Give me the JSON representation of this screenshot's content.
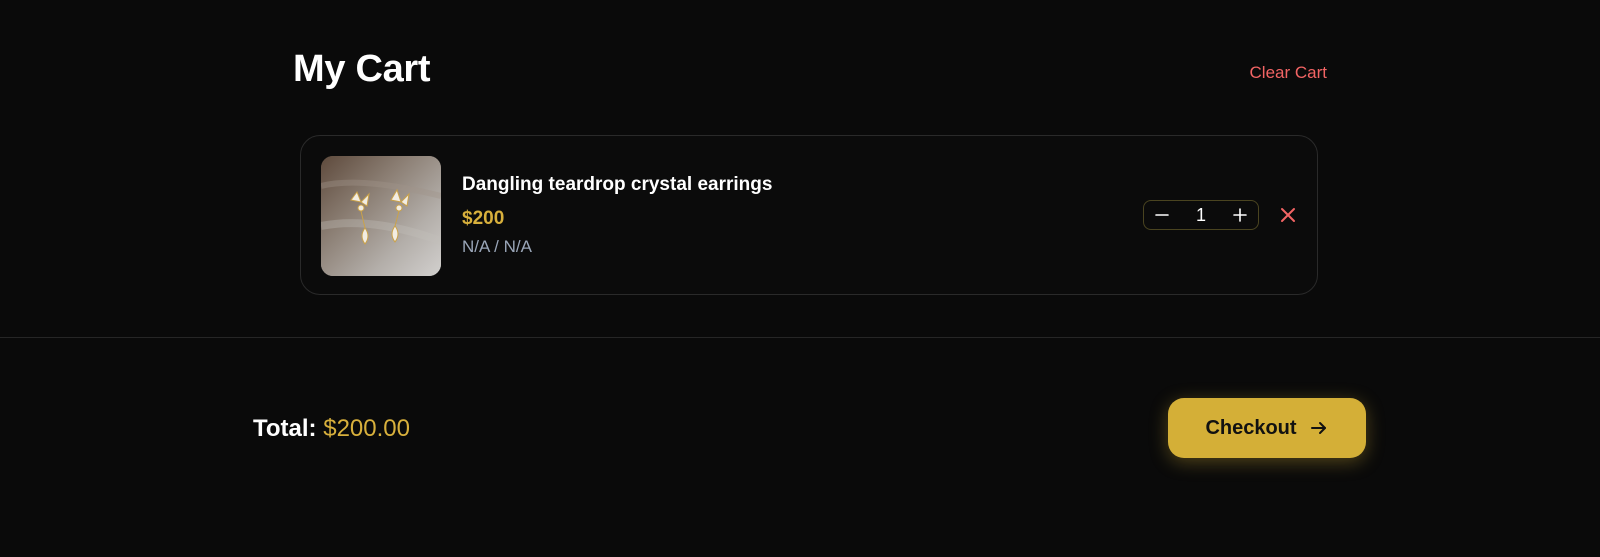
{
  "header": {
    "title": "My Cart",
    "clear_label": "Clear Cart"
  },
  "cart": {
    "items": [
      {
        "name": "Dangling teardrop crystal earrings",
        "price": "$200",
        "variant": "N/A / N/A",
        "quantity": "1",
        "image_icon": "earrings-photo"
      }
    ]
  },
  "summary": {
    "total_label": "Total:",
    "total_amount": "$200.00",
    "checkout_label": "Checkout"
  },
  "colors": {
    "background": "#0a0a0a",
    "accent_gold": "#d4af37",
    "price_gold": "#d8b03c",
    "danger": "#f26464",
    "muted_text": "#9aa6b8"
  }
}
